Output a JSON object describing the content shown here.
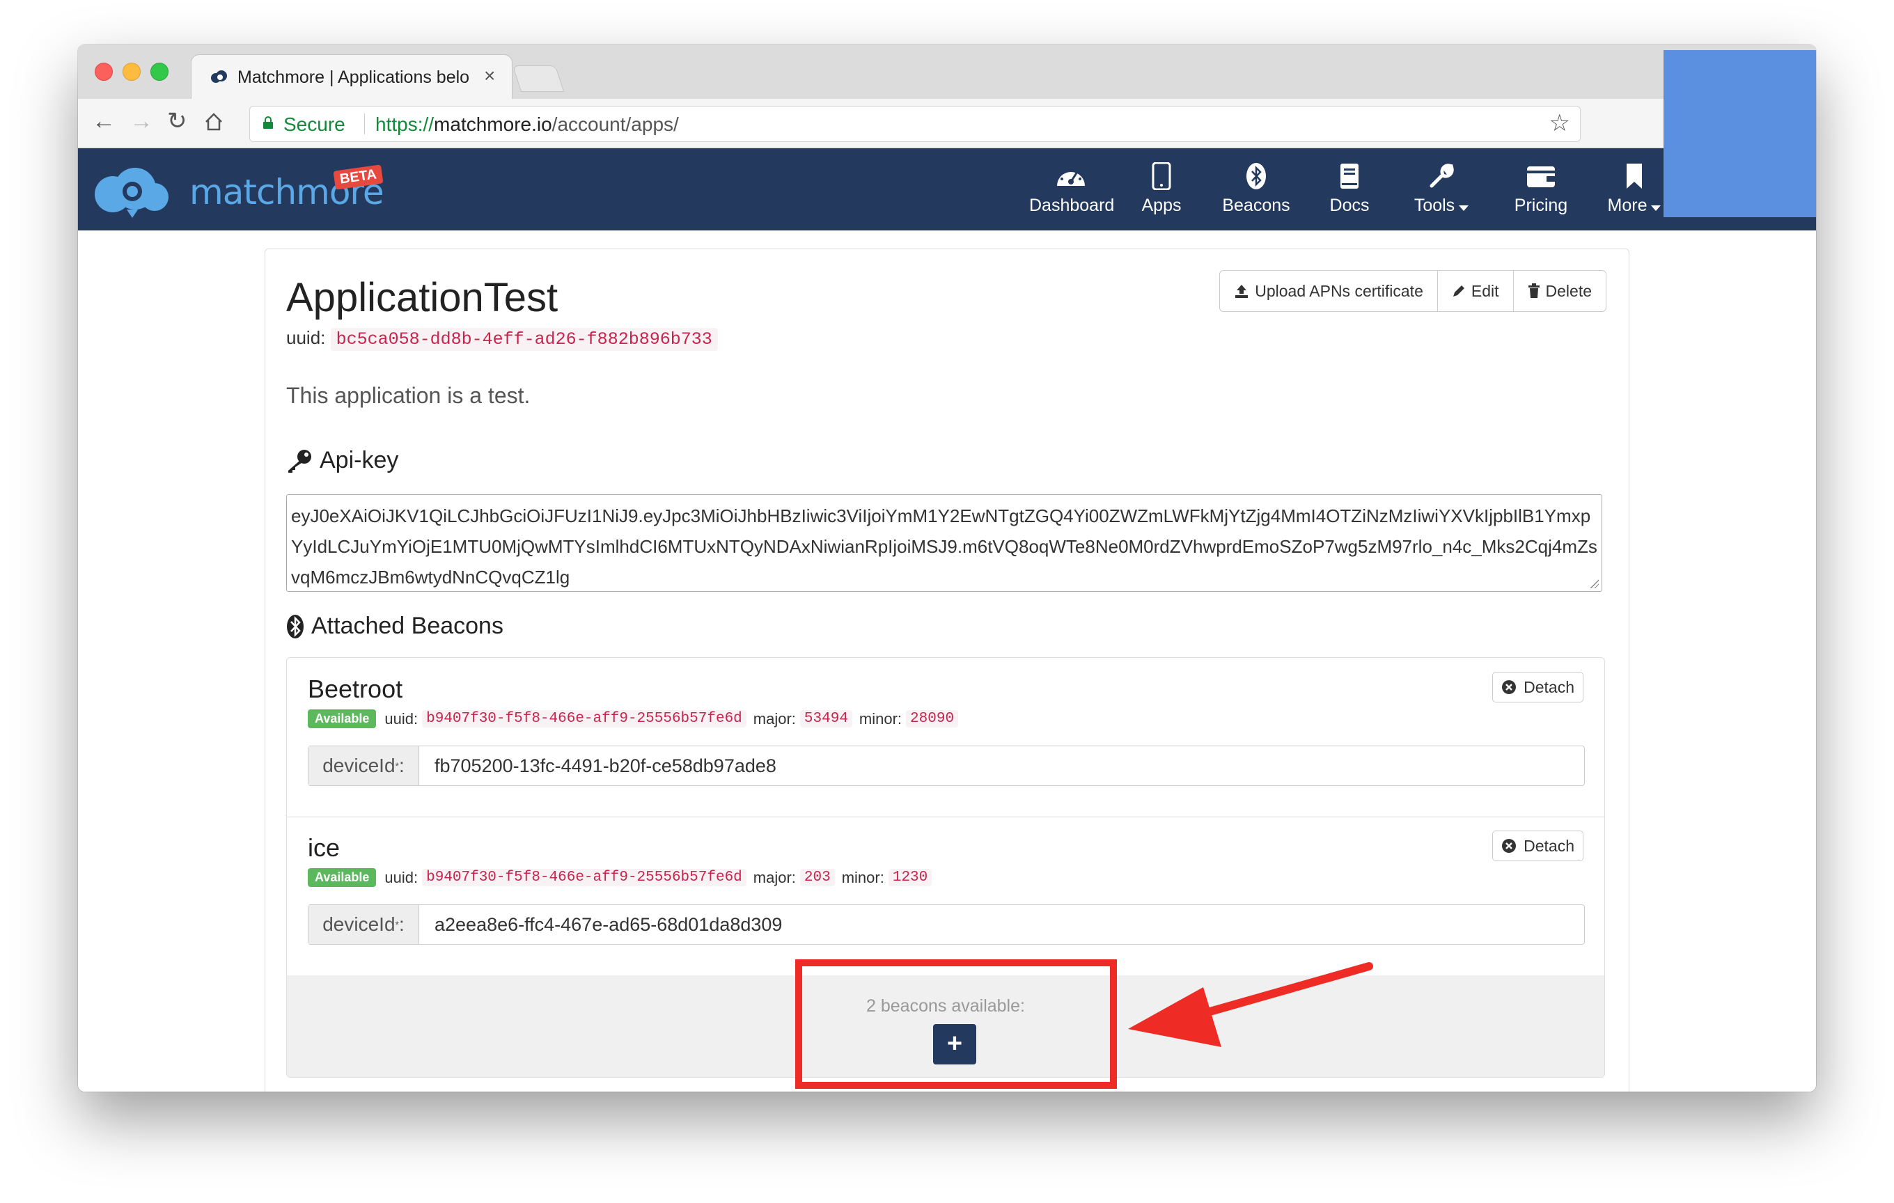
{
  "browser": {
    "tab_title": "Matchmore | Applications belo",
    "tab_close": "×",
    "secure_label": "Secure",
    "url_scheme": "https://",
    "url_host": "matchmore.io",
    "url_path": "/account/apps/"
  },
  "site": {
    "logo_text": "matchmore",
    "beta_badge": "BETA",
    "nav": [
      {
        "label": "Dashboard"
      },
      {
        "label": "Apps"
      },
      {
        "label": "Beacons"
      },
      {
        "label": "Docs"
      },
      {
        "label": "Tools"
      },
      {
        "label": "Pricing"
      },
      {
        "label": "More"
      }
    ]
  },
  "app": {
    "title": "ApplicationTest",
    "uuid_label": "uuid:",
    "uuid": "bc5ca058-dd8b-4eff-ad26-f882b896b733",
    "description": "This application is a test.",
    "buttons": {
      "upload": "Upload APNs certificate",
      "edit": "Edit",
      "delete": "Delete"
    },
    "api_key_heading": "Api-key",
    "api_key": "eyJ0eXAiOiJKV1QiLCJhbGciOiJFUzI1NiJ9.eyJpc3MiOiJhbHBzIiwic3ViIjoiYmM1Y2EwNTgtZGQ4Yi00ZWZmLWFkMjYtZjg4MmI4OTZiNzMzIiwiYXVkIjpbIlB1YmxpYyIdLCJuYmYiOjE1MTU0MjQwMTYsImlhdCI6MTUxNTQyNDAxNiwianRpIjoiMSJ9.m6tVQ8oqWTe8Ne0M0rdZVhwprdEmoSZoP7wg5zM97rlo_n4c_Mks2Cqj4mZsvqM6mczJBm6wtydNnCQvqCZ1lg",
    "beacons_heading": "Attached Beacons"
  },
  "beacons": [
    {
      "name": "Beetroot",
      "status": "Available",
      "uuid_label": "uuid:",
      "uuid": "b9407f30-f5f8-466e-aff9-25556b57fe6d",
      "major_label": "major:",
      "major": "53494",
      "minor_label": "minor:",
      "minor": "28090",
      "device_label": "deviceId",
      "device_suffix": ":",
      "device_id": "fb705200-13fc-4491-b20f-ce58db97ade8",
      "detach": "Detach"
    },
    {
      "name": "ice",
      "status": "Available",
      "uuid_label": "uuid:",
      "uuid": "b9407f30-f5f8-466e-aff9-25556b57fe6d",
      "major_label": "major:",
      "major": "203",
      "minor_label": "minor:",
      "minor": "1230",
      "device_label": "deviceId",
      "device_suffix": ":",
      "device_id": "a2eea8e6-ffc4-467e-ad65-68d01da8d309",
      "detach": "Detach"
    }
  ],
  "footer": {
    "available_text": "2 beacons available:",
    "add_label": "+"
  },
  "colors": {
    "header": "#233a5e",
    "annotation": "#ee2b24",
    "overlay_block": "#5b8fe0",
    "available": "#5cb85c",
    "code": "#c7254e"
  }
}
